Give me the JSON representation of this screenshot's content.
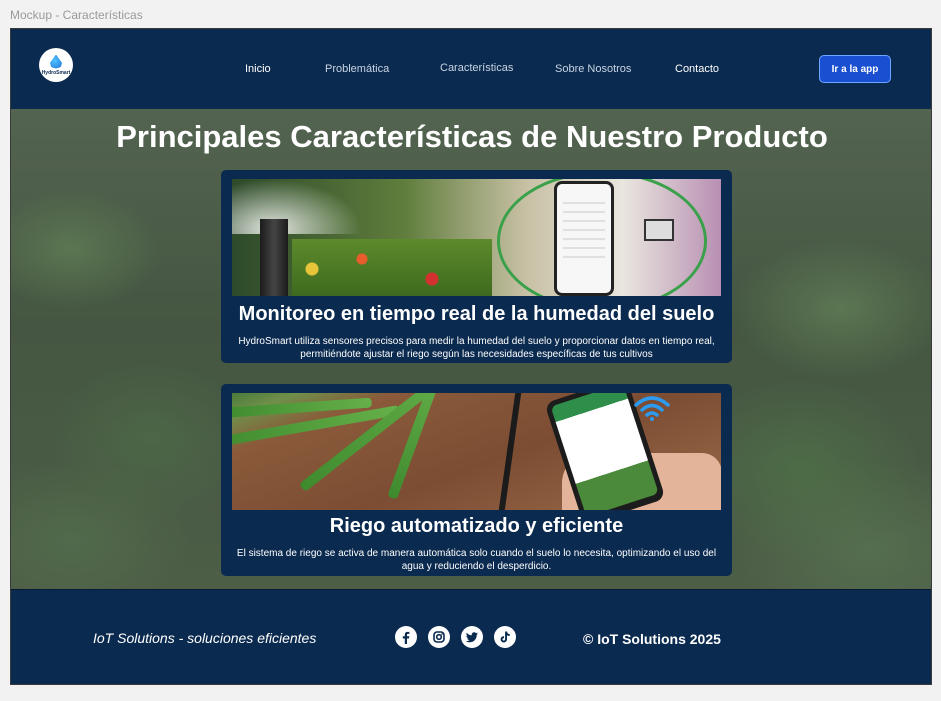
{
  "window": {
    "title": "Mockup - Características"
  },
  "header": {
    "logo_text": "HydroSmart",
    "nav": [
      {
        "label": "Inicio"
      },
      {
        "label": "Problemática"
      },
      {
        "label": "Características"
      },
      {
        "label": "Sobre Nosotros"
      },
      {
        "label": "Contacto"
      }
    ],
    "cta_label": "Ir a la app"
  },
  "hero": {
    "title": "Principales Características de Nuestro Producto",
    "cards": [
      {
        "title": "Monitoreo en tiempo real de la humedad del suelo",
        "description": "HydroSmart utiliza sensores precisos para medir la humedad del suelo y proporcionar datos en tiempo real, permitiéndote ajustar el riego según las necesidades específicas de tus cultivos"
      },
      {
        "title": "Riego automatizado y eficiente",
        "description": "El sistema de riego se activa de manera automática solo cuando el suelo lo necesita, optimizando el uso del agua y reduciendo el desperdicio."
      }
    ]
  },
  "footer": {
    "tagline": "IoT Solutions - soluciones eficientes",
    "socials": [
      "facebook-icon",
      "instagram-icon",
      "twitter-icon",
      "tiktok-icon"
    ],
    "copyright": "© IoT Solutions 2025"
  },
  "colors": {
    "navy": "#0b2a4f",
    "cta_blue": "#1a4fd1",
    "text": "#ffffff"
  }
}
